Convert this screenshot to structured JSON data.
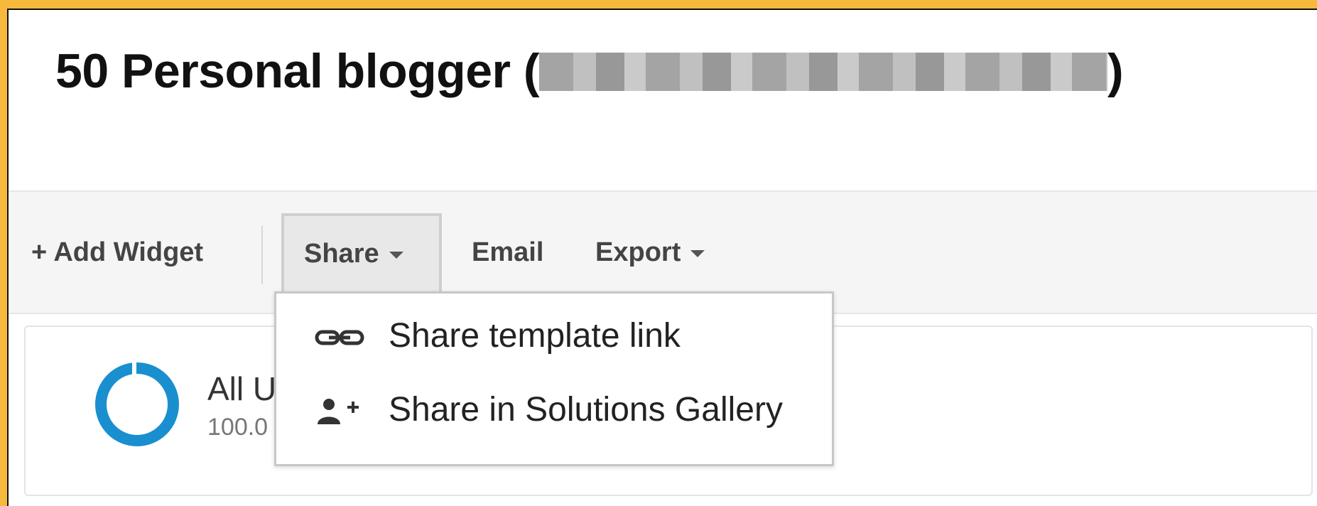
{
  "header": {
    "title_prefix": "50 Personal blogger (",
    "title_suffix": ")"
  },
  "toolbar": {
    "add_widget_label": "+ Add Widget",
    "share_label": "Share",
    "email_label": "Email",
    "export_label": "Export"
  },
  "segment": {
    "name": "All U",
    "percent": "100.0"
  },
  "share_menu": {
    "items": [
      {
        "label": "Share template link",
        "icon": "link-icon"
      },
      {
        "label": "Share in Solutions Gallery",
        "icon": "add-person-icon"
      }
    ]
  },
  "colors": {
    "frame_border": "#f6b93b",
    "donut": "#1a8fcf"
  }
}
